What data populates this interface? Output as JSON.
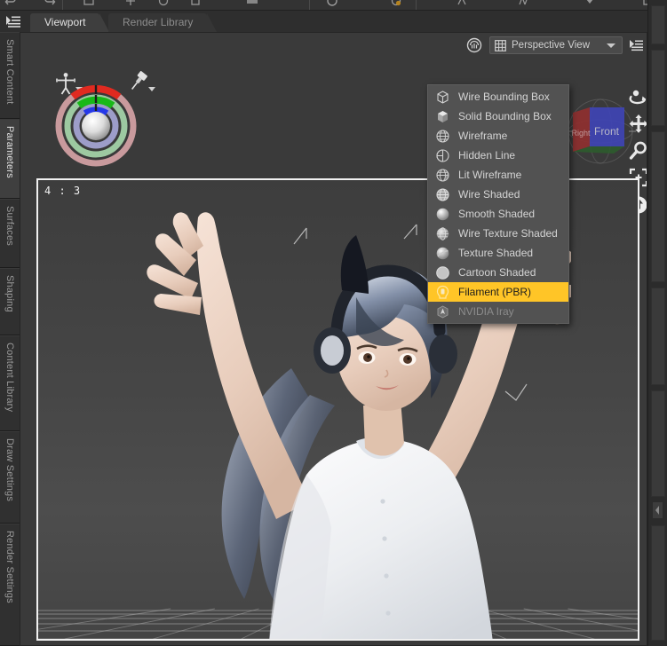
{
  "app": {
    "theme_bg": "#2b2b2b",
    "panel_bg": "#3a3a3a",
    "accent": "#ffc527",
    "text": "#c8c8c8"
  },
  "toolbar": {
    "menu_icon": "panel-options-icon",
    "icons": [
      "undo-icon",
      "redo-icon",
      "separator",
      "render-icon",
      "spot-render-icon",
      "iray-preview-icon",
      "separator",
      "node-icon",
      "surface-icon",
      "shape-icon",
      "frame-icon",
      "separator",
      "pose-icon",
      "anim-icon",
      "scene-icon",
      "light-icon"
    ]
  },
  "tabs": {
    "items": [
      {
        "label": "Viewport",
        "selected": true
      },
      {
        "label": "Render Library",
        "selected": false
      }
    ]
  },
  "sidebar": {
    "items": [
      {
        "label": "Smart Content",
        "selected": false
      },
      {
        "label": "Parameters",
        "selected": true
      },
      {
        "label": "Surfaces",
        "selected": false
      },
      {
        "label": "Shaping",
        "selected": false
      },
      {
        "label": "Content Library",
        "selected": false
      },
      {
        "label": "Draw Settings",
        "selected": false
      },
      {
        "label": "Render Settings",
        "selected": false
      }
    ]
  },
  "viewport": {
    "aspect_ratio": "4 : 3",
    "view_selector": {
      "label": "Perspective View",
      "icon": "viewport-grid-icon",
      "arrow": "chevron-down-icon"
    },
    "draw_style_button_icon": "draw-style-icon",
    "option_button_icon": "viewport-options-icon",
    "gizmo": {
      "name": "orientation-gizmo",
      "ring_colors": [
        "#c99a9d",
        "#9dc9a1",
        "#9d9dc9"
      ],
      "axis_colors": {
        "x": "#e02a20",
        "y": "#18b818",
        "z": "#2638e8"
      }
    },
    "nav_cube": {
      "front_label": "Front",
      "right_label": "Right",
      "front_color": "#3f44b4",
      "right_color": "#8f3030",
      "top_color": "#2d5c2d"
    },
    "camera_tools": [
      {
        "name": "orbit-camera-icon"
      },
      {
        "name": "pan-camera-icon"
      },
      {
        "name": "zoom-camera-icon"
      },
      {
        "name": "frame-camera-icon"
      },
      {
        "name": "reset-camera-icon"
      }
    ],
    "figure_tool_icon": "figure-select-icon",
    "pin_tool_icon": "pin-icon"
  },
  "draw_style_menu": {
    "visible": true,
    "highlight_color": "#ffc527",
    "items": [
      {
        "label": "Wire Bounding Box",
        "icon": "wire-bounding-box-icon",
        "state": "normal"
      },
      {
        "label": "Solid Bounding Box",
        "icon": "solid-bounding-box-icon",
        "state": "normal"
      },
      {
        "label": "Wireframe",
        "icon": "wireframe-icon",
        "state": "normal"
      },
      {
        "label": "Hidden Line",
        "icon": "hidden-line-icon",
        "state": "normal"
      },
      {
        "label": "Lit Wireframe",
        "icon": "lit-wireframe-icon",
        "state": "normal"
      },
      {
        "label": "Wire Shaded",
        "icon": "wire-shaded-icon",
        "state": "normal"
      },
      {
        "label": "Smooth Shaded",
        "icon": "smooth-shaded-icon",
        "state": "normal"
      },
      {
        "label": "Wire Texture Shaded",
        "icon": "wire-texture-shaded-icon",
        "state": "normal"
      },
      {
        "label": "Texture Shaded",
        "icon": "texture-shaded-icon",
        "state": "normal"
      },
      {
        "label": "Cartoon Shaded",
        "icon": "cartoon-shaded-icon",
        "state": "normal"
      },
      {
        "label": "Filament (PBR)",
        "icon": "filament-icon",
        "state": "highlight"
      },
      {
        "label": "NVIDIA Iray",
        "icon": "nvidia-iray-icon",
        "state": "disabled"
      }
    ]
  },
  "scene": {
    "description": "3D female character posed with both arms raised, wearing a white short-sleeve shirt and cat-ear headphones, standing on a perspective grid floor",
    "floor": "perspective-grid"
  }
}
